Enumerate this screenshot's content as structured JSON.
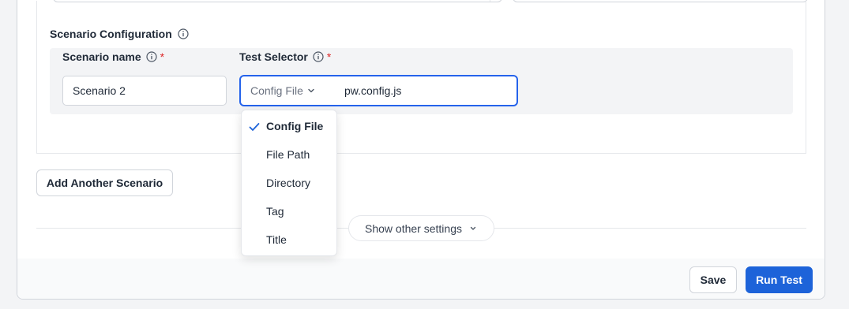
{
  "scenario_config": {
    "title": "Scenario Configuration",
    "scenario_name_label": "Scenario name",
    "scenario_name_value": "Scenario 2",
    "test_selector_label": "Test Selector",
    "required_marker": "*",
    "selector_type": "Config File",
    "selector_value": "pw.config.js"
  },
  "dropdown": {
    "selected": "Config File",
    "items": [
      "Config File",
      "File Path",
      "Directory",
      "Tag",
      "Title"
    ]
  },
  "actions": {
    "add_scenario": "Add Another Scenario",
    "show_other_settings": "Show other settings",
    "save": "Save",
    "run_test": "Run Test"
  },
  "colors": {
    "primary": "#1d63d9",
    "focus_border": "#2563eb",
    "required": "#dc2626",
    "check": "#1d63d9"
  },
  "icons": [
    "info-icon",
    "chevron-down-icon",
    "check-icon"
  ]
}
